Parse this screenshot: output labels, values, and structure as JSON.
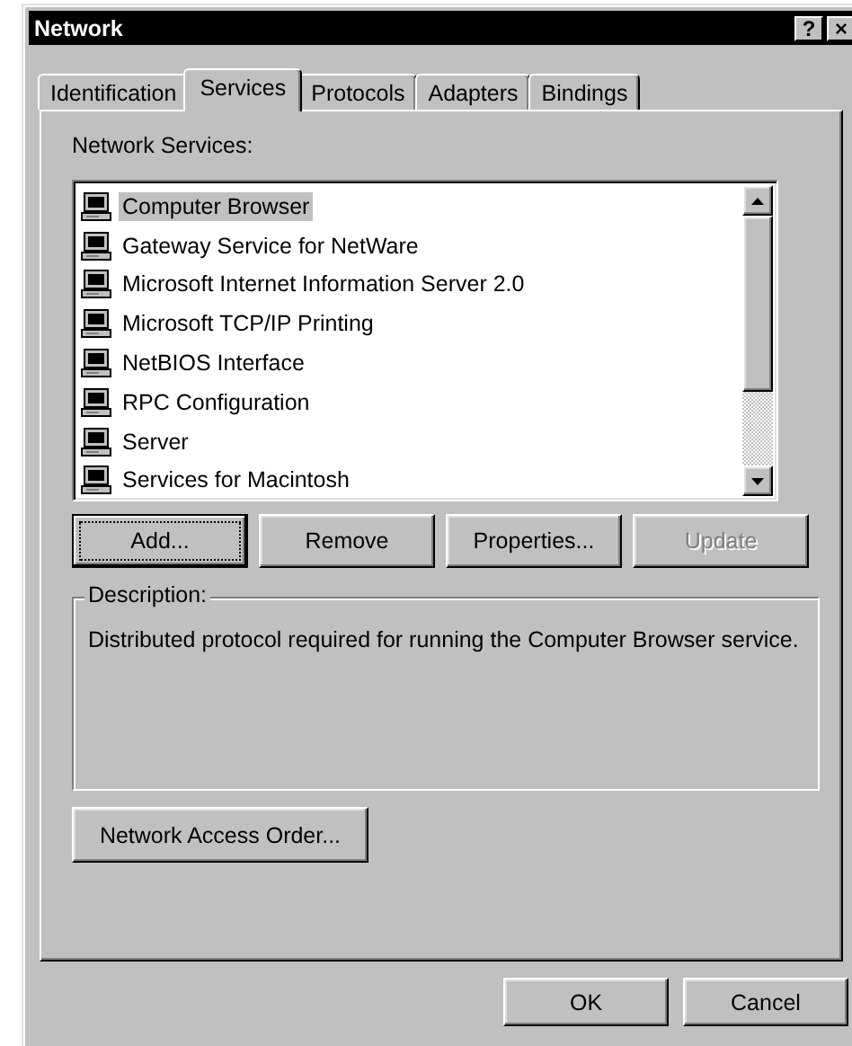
{
  "window": {
    "title": "Network",
    "title_buttons": [
      "?",
      "×"
    ]
  },
  "tabs": [
    {
      "label": "Identification",
      "selected": false
    },
    {
      "label": "Services",
      "selected": true
    },
    {
      "label": "Protocols",
      "selected": false
    },
    {
      "label": "Adapters",
      "selected": false
    },
    {
      "label": "Bindings",
      "selected": false
    }
  ],
  "services": {
    "label": "Network Services:",
    "items": [
      {
        "name": "Computer Browser",
        "selected": true
      },
      {
        "name": "Gateway Service for NetWare",
        "selected": false
      },
      {
        "name": "Microsoft Internet Information Server 2.0",
        "selected": false
      },
      {
        "name": "Microsoft TCP/IP Printing",
        "selected": false
      },
      {
        "name": "NetBIOS Interface",
        "selected": false
      },
      {
        "name": "RPC Configuration",
        "selected": false
      },
      {
        "name": "Server",
        "selected": false
      },
      {
        "name": "Services for Macintosh",
        "selected": false
      }
    ]
  },
  "service_buttons": [
    {
      "label": "Add...",
      "disabled": false,
      "focused": true
    },
    {
      "label": "Remove",
      "disabled": false,
      "focused": false
    },
    {
      "label": "Properties...",
      "disabled": false,
      "focused": false
    },
    {
      "label": "Update",
      "disabled": true,
      "focused": false
    }
  ],
  "description": {
    "title": "Description:",
    "text": "Distributed protocol required for running the Computer Browser service."
  },
  "access_order_button": {
    "label": "Network Access Order..."
  },
  "dialog_buttons": [
    {
      "label": "OK"
    },
    {
      "label": "Cancel"
    }
  ]
}
